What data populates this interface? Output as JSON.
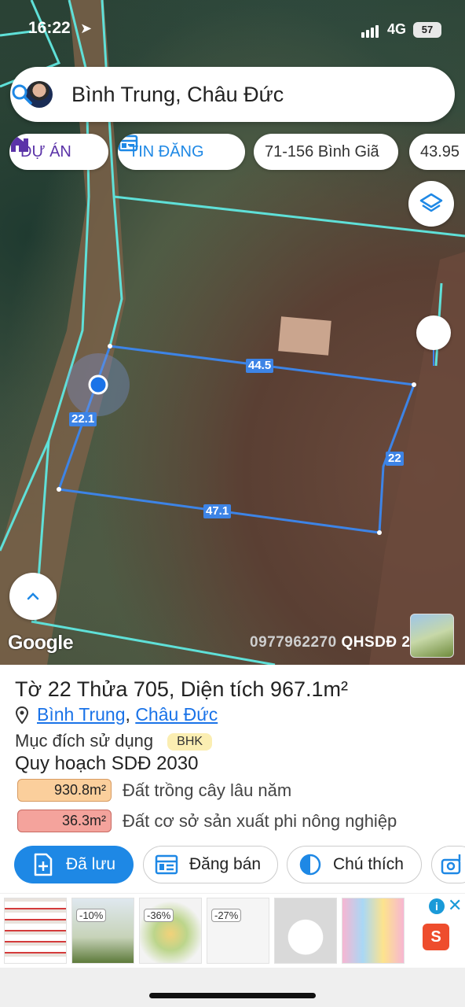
{
  "status_bar": {
    "time": "16:22",
    "network": "4G",
    "battery": "57"
  },
  "search": {
    "title": "Bình Trung, Châu Đức"
  },
  "chips": [
    {
      "label": "DỰ ÁN",
      "icon": "house-building-icon",
      "color": "#5b33a8"
    },
    {
      "label": "TIN ĐĂNG",
      "icon": "listing-icon",
      "color": "#1e88e5"
    },
    {
      "label": "71-156 Bình Giã"
    },
    {
      "label": "43.95"
    }
  ],
  "map": {
    "segment_lengths": {
      "top": "44.5",
      "left": "22.1",
      "right": "22",
      "bottom": "47.1"
    },
    "google_logo": "Google",
    "phone": "0977962270",
    "layer_name": "QHSDĐ 2030"
  },
  "parcel": {
    "title": "Tờ 22 Thửa 705, Diện tích 967.1m²",
    "commune": "Bình Trung",
    "separator": ",",
    "district": "Châu Đức",
    "purpose_label": "Mục đích sử dụng",
    "purpose_code": "BHK",
    "plan_label": "Quy hoạch SDĐ 2030",
    "land_use": [
      {
        "area": "930.8m²",
        "desc": "Đất trồng cây lâu năm",
        "color": "#fbcf9c"
      },
      {
        "area": "36.3m²",
        "desc": "Đất cơ sở sản xuất phi nông nghiệp",
        "color": "#f4a39c"
      }
    ]
  },
  "actions": {
    "saved": "Đã lưu",
    "sell": "Đăng bán",
    "legend": "Chú thích"
  },
  "ads": {
    "discounts": [
      "-10%",
      "-36%",
      "-27%"
    ],
    "shop_logo": "S"
  },
  "colors": {
    "accent_blue": "#1e88e5",
    "parcel_line": "#3d84e6",
    "boundary_cyan": "#5fe0d8"
  }
}
